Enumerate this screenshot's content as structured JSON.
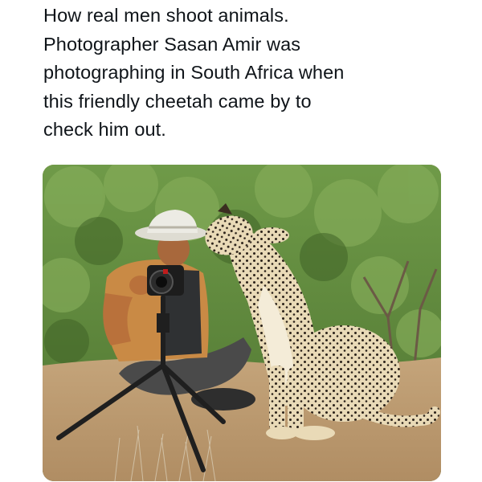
{
  "post": {
    "caption_lines": [
      "How real men shoot animals.",
      "Photographer Sasan Amir was",
      "photographing in South Africa when",
      "this friendly cheetah came by to",
      "check him out."
    ]
  },
  "colors": {
    "text": "#0f1419",
    "background": "#ffffff",
    "bush_green": "#5f8a3c",
    "ground_tan": "#b9996f",
    "shirt_orange": "#c98a45",
    "hat_white": "#ecebe4",
    "cheetah_fur": "#e7d7b2"
  },
  "icons": {
    "photo_subject": "photographer-with-cheetah-image"
  }
}
